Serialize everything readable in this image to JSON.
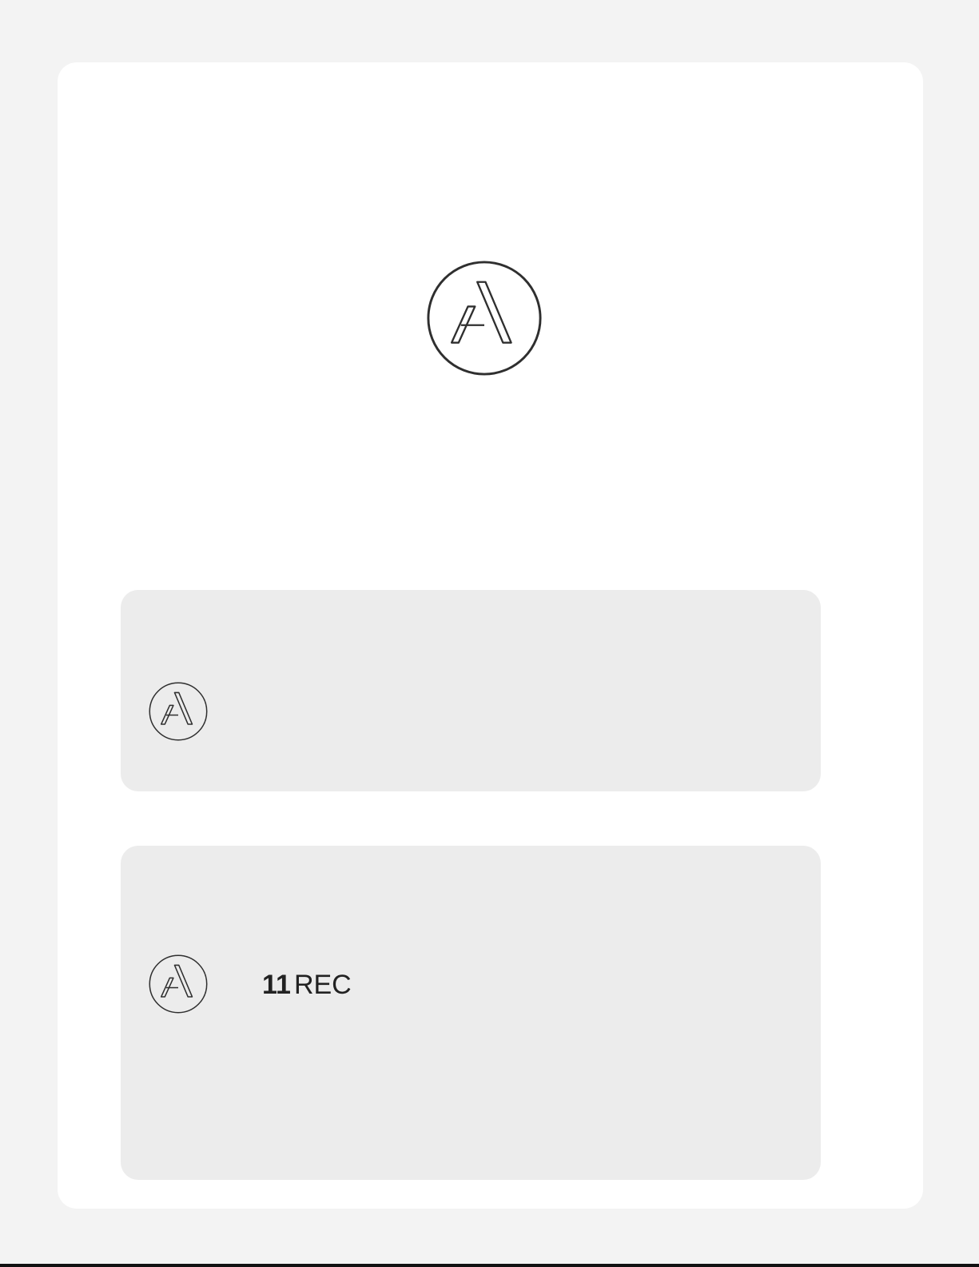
{
  "brand": {
    "logo_icon": "a-monogram-logo-icon",
    "logo_stroke_color": "#2f2f2f"
  },
  "colors": {
    "page_background": "#f3f3f3",
    "card_background": "#ffffff",
    "panel_background": "#ececec",
    "text": "#222222"
  },
  "panels": [
    {
      "icon": "a-monogram-logo-icon",
      "count": "",
      "unit": ""
    },
    {
      "icon": "a-monogram-logo-icon",
      "count": "11",
      "unit": "REC"
    }
  ]
}
